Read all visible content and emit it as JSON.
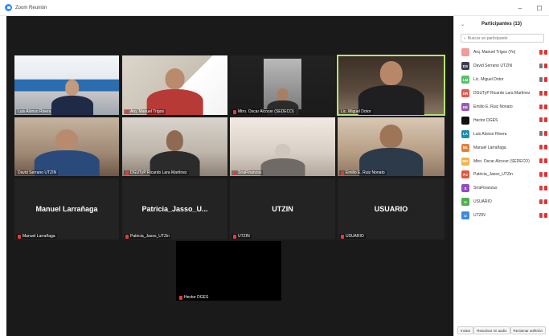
{
  "window": {
    "title": "Zoom Reunión"
  },
  "controls": {
    "minimize": "–",
    "maximize": "☐"
  },
  "tiles": [
    {
      "name": "Luis Alonso Rivera"
    },
    {
      "name": "Arq. Manuel Trigos"
    },
    {
      "name": "Mtro. Oscar Alcocer (SEDECO)"
    },
    {
      "name": "Lic. Miguel Dotor"
    },
    {
      "name": "David Serrano UTZIN"
    },
    {
      "name": "DGUTyP Ricardo Lara Martínez"
    },
    {
      "name": "SríaFinanzas"
    },
    {
      "name": "Emilio E. Ruiz Nonato"
    },
    {
      "name": "Manuel Larrañaga",
      "big": "Manuel Larrañaga"
    },
    {
      "name": "Patricia_Jasso_UTZin",
      "big": "Patricia_Jasso_U..."
    },
    {
      "name": "UTZIN",
      "big": "UTZIN"
    },
    {
      "name": "USUARIO",
      "big": "USUARIO"
    },
    {
      "name": "Hector DGES"
    }
  ],
  "sidebar": {
    "title": "Participantes (13)",
    "search_placeholder": "Buscar un participante",
    "participants": [
      {
        "initials": "",
        "name": "Arq. Manuel Trigos (Yo)",
        "color": "#f29a9a"
      },
      {
        "initials": "DS",
        "name": "David Serrano UTZIN",
        "color": "#3b3f4c"
      },
      {
        "initials": "LM",
        "name": "Lic. Miguel Dotor",
        "color": "#58c06b"
      },
      {
        "initials": "DR",
        "name": "DGUTyP Ricardo Lara Martínez",
        "color": "#e05a4f"
      },
      {
        "initials": "EE",
        "name": "Emilio E. Ruiz Nonato",
        "color": "#9b59b6"
      },
      {
        "initials": "",
        "name": "Hector DGES",
        "color": "#111111"
      },
      {
        "initials": "LA",
        "name": "Luis Alonso Rivera",
        "color": "#1f8ea8"
      },
      {
        "initials": "ML",
        "name": "Manuel Larrañaga",
        "color": "#e4813a"
      },
      {
        "initials": "MO",
        "name": "Mtro. Oscar Alcocer (SEDECO)",
        "color": "#f2b246"
      },
      {
        "initials": "PJ",
        "name": "Patricia_Jasso_UTZin",
        "color": "#e0563f"
      },
      {
        "initials": "S",
        "name": "SríaFinanzas",
        "color": "#8e4dc6"
      },
      {
        "initials": "U",
        "name": "USUARIO",
        "color": "#4caf50"
      },
      {
        "initials": "U",
        "name": "UTZIN",
        "color": "#3d8bd9"
      }
    ],
    "footer": {
      "invite": "Invitar",
      "unmute": "Reactivar mi audio",
      "reclaim": "Reclamar anfitrión"
    }
  }
}
